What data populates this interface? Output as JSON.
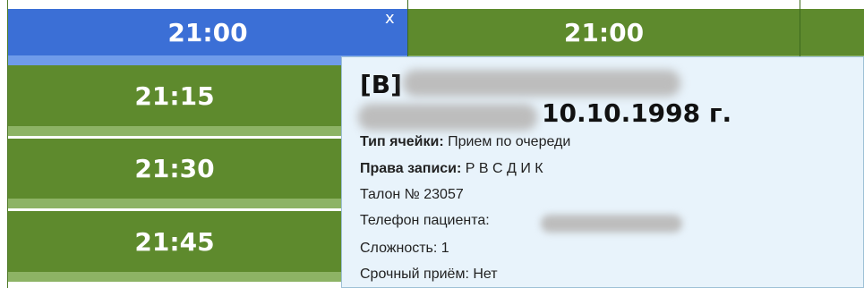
{
  "schedule": {
    "times": {
      "t1": "21:00",
      "t2": "21:00",
      "t3": "21:15",
      "t4": "21:30",
      "t5": "21:45"
    },
    "close_symbol": "x",
    "colors": {
      "slot_green": "#5e8a2d",
      "slot_selected_blue": "#3b6fd6",
      "stripe_green": "#8db365",
      "stripe_blue": "#6f9bea"
    }
  },
  "tooltip": {
    "patient_id_prefix": "[B]",
    "birth_date": "10.10.1998 г.",
    "cell_type_label": "Тип ячейки:",
    "cell_type_value": "Прием по очереди",
    "rights_label": "Права записи:",
    "rights_value": "Р В С Д И К",
    "ticket": "Талон № 23057",
    "phone_label": "Телефон пациента:",
    "complexity": "Сложность: 1",
    "urgent": "Срочный приём: Нет",
    "background": "#e8f3fb"
  }
}
